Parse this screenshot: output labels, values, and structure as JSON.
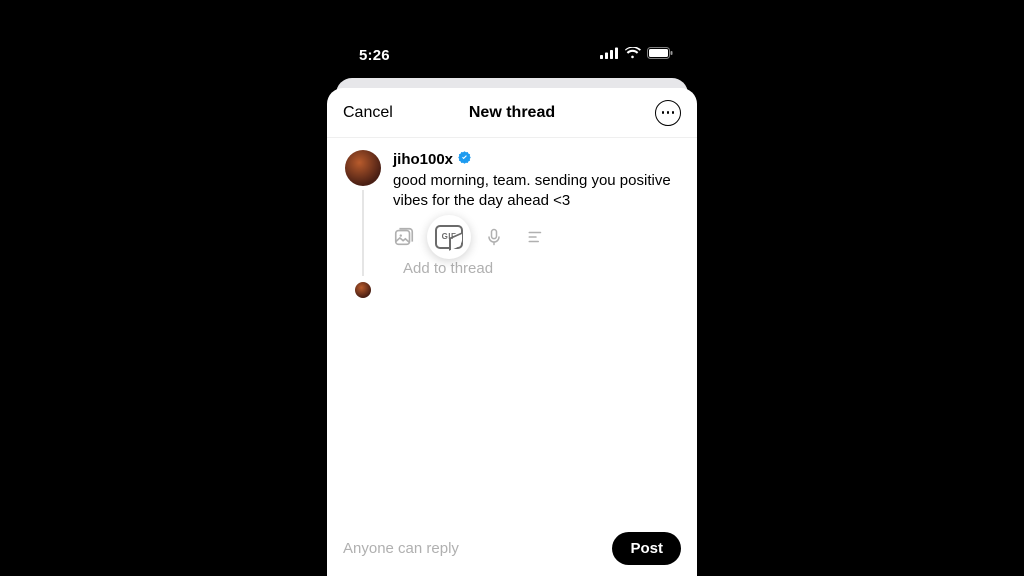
{
  "statusbar": {
    "time": "5:26"
  },
  "sheet": {
    "cancel": "Cancel",
    "title": "New thread"
  },
  "post": {
    "username": "jiho100x",
    "body": "good morning, team. sending you positive vibes for the day ahead <3"
  },
  "gif_label": "GIF",
  "add_placeholder": "Add to thread",
  "footer": {
    "reply_hint": "Anyone can reply",
    "post_label": "Post"
  }
}
